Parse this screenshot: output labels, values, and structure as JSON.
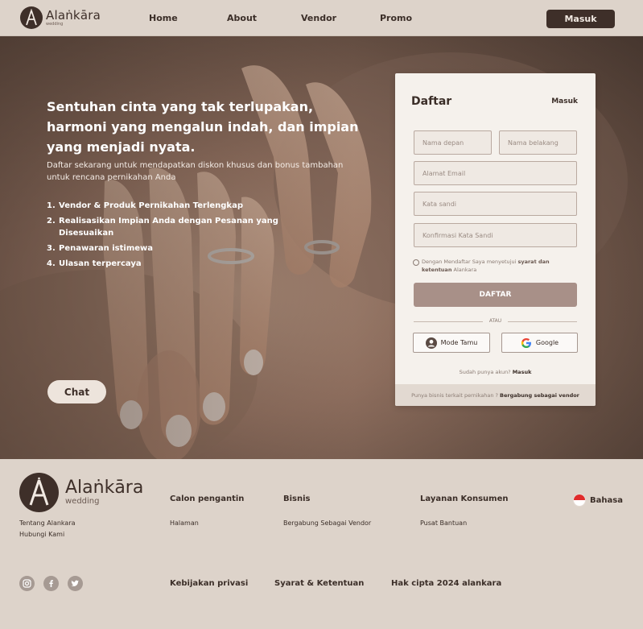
{
  "nav": {
    "brand": "Alaṅkāra",
    "brand_sub": "wedding",
    "links": [
      "Home",
      "About",
      "Vendor",
      "Promo"
    ],
    "login_button": "Masuk"
  },
  "hero": {
    "title": "Sentuhan cinta yang tak terlupakan, harmoni yang mengalun indah, dan impian yang menjadi nyata.",
    "subtitle": "Daftar sekarang untuk mendapatkan diskon khusus dan bonus tambahan untuk rencana pernikahan Anda",
    "list": [
      {
        "num": "1.",
        "text": "Vendor & Produk Pernikahan Terlengkap"
      },
      {
        "num": "2.",
        "text": "Realisasikan Impian Anda dengan Pesanan yang Disesuaikan"
      },
      {
        "num": "3.",
        "text": "Penawaran istimewa"
      },
      {
        "num": "4.",
        "text": "Ulasan terpercaya"
      }
    ],
    "chat_button": "Chat"
  },
  "form": {
    "title": "Daftar",
    "login_link": "Masuk",
    "first_name_placeholder": "Nama depan",
    "last_name_placeholder": "Nama belakang",
    "email_placeholder": "Alamat Email",
    "password_placeholder": "Kata sandi",
    "confirm_placeholder": "Konfirmasi Kata Sandi",
    "terms_prefix": "Dengan Mendaftar Saya menyetujui",
    "terms_bold": "syarat dan ketentuan",
    "terms_suffix": "Alankara",
    "submit": "DAFTAR",
    "divider": "ATAU",
    "guest_button": "Mode Tamu",
    "google_button": "Google",
    "have_account": "Sudah punya akun?",
    "have_account_link": "Masuk",
    "business_text": "Punya bisnis terkait pernikahan ?",
    "business_link": "Bergabung sebagai vendor"
  },
  "footer": {
    "brand": "Alaṅkāra",
    "brand_sub": "wedding",
    "about": "Tentang Alankara",
    "contact": "Hubungi Kami",
    "col1_title": "Calon pengantin",
    "col1_link": "Halaman",
    "col2_title": "Bisnis",
    "col2_link": "Bergabung Sebagai Vendor",
    "col3_title": "Layanan Konsumen",
    "col3_link": "Pusat Bantuan",
    "language": "Bahasa",
    "privacy": "Kebijakan privasi",
    "terms": "Syarat & Ketentuan",
    "copyright": "Hak cipta 2024 alankara",
    "social_icons": [
      "instagram-icon",
      "facebook-icon",
      "twitter-icon"
    ]
  },
  "colors": {
    "brand_dark": "#3e2f29",
    "background": "#ddd3ca",
    "card": "#f5f1ec",
    "submit": "#a89088"
  }
}
